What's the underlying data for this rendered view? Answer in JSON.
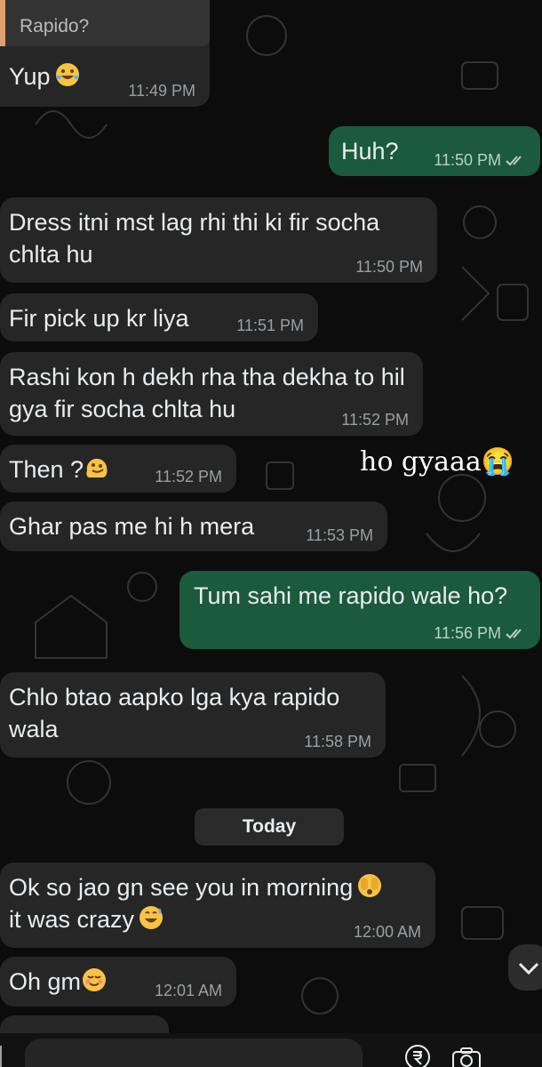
{
  "chat": {
    "reply_quote": "Rapido?",
    "overlay_caption": "ho gyaaa😭",
    "date_separator": "Today",
    "messages": [
      {
        "text": "Yup",
        "time": "11:49 PM",
        "outgoing": false
      },
      {
        "text": "Huh?",
        "time": "11:50 PM",
        "outgoing": true
      },
      {
        "text": "Dress itni mst lag rhi thi ki fir socha chlta hu",
        "time": "11:50 PM",
        "outgoing": false
      },
      {
        "text": "Fir pick up kr liya",
        "time": "11:51 PM",
        "outgoing": false
      },
      {
        "text": "Rashi kon h dekh rha tha dekha to hil gya fir socha chlta hu",
        "time": "11:52 PM",
        "outgoing": false
      },
      {
        "text": "Then ?",
        "time": "11:52 PM",
        "outgoing": false
      },
      {
        "text": "Ghar pas me hi h mera",
        "time": "11:53 PM",
        "outgoing": false
      },
      {
        "text": "Tum sahi me rapido wale ho?",
        "time": "11:56 PM",
        "outgoing": true
      },
      {
        "text": "Chlo btao aapko lga kya rapido wala",
        "time": "11:58 PM",
        "outgoing": false
      },
      {
        "text": "Ok so jao gn see you in morning",
        "text2": "it was crazy",
        "time": "12:00 AM",
        "outgoing": false
      },
      {
        "text": "Oh gm",
        "time": "12:01 AM",
        "outgoing": false
      }
    ]
  },
  "colors": {
    "background": "#0c0c0c",
    "incoming_bubble": "#262626",
    "outgoing_bubble": "#1b5a3d",
    "text": "#e9edef",
    "timestamp": "#9aa0a3",
    "read_ticks": "#b9d3c6"
  },
  "icons": [
    "double-check-icon",
    "rolling-laughing-emoji",
    "melting-face-emoji",
    "peeking-face-emoji",
    "sweat-smile-emoji",
    "smiling-face-emoji",
    "chevron-down-icon",
    "rupee-icon",
    "camera-icon"
  ]
}
